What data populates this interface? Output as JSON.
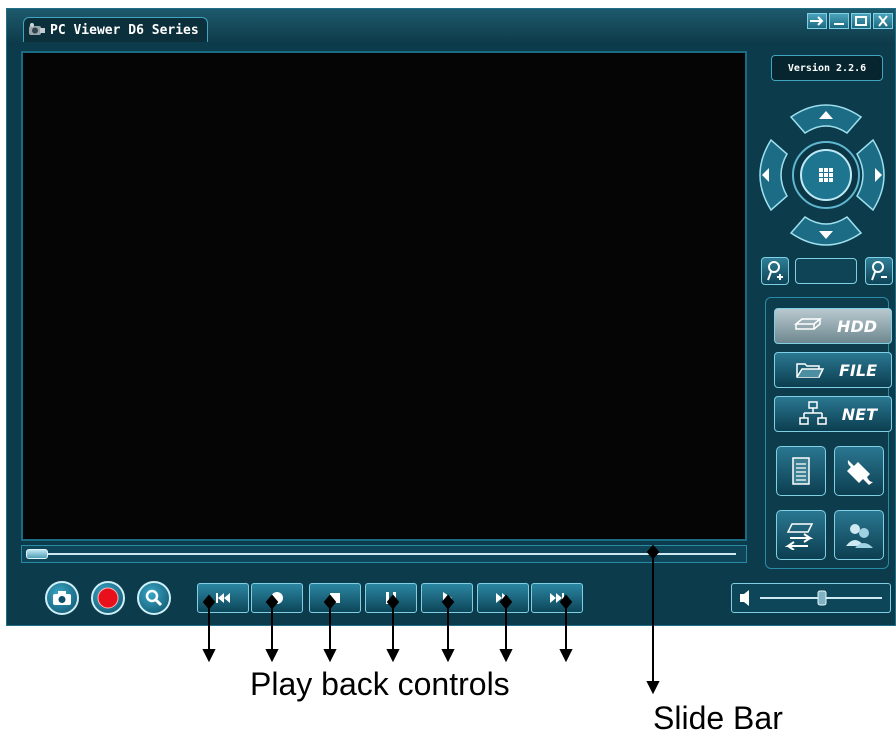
{
  "window": {
    "title": "PC Viewer D6 Series",
    "version": "Version 2.2.6",
    "controls": [
      "pin-icon",
      "minimize-icon",
      "maximize-icon",
      "close-icon"
    ]
  },
  "modes": [
    {
      "id": "hdd",
      "label": "HDD",
      "icon": "hdd-icon",
      "active": true
    },
    {
      "id": "file",
      "label": "FILE",
      "icon": "folder-icon",
      "active": false
    },
    {
      "id": "net",
      "label": "NET",
      "icon": "network-icon",
      "active": false
    }
  ],
  "tools": [
    "list-icon",
    "wrench-icon",
    "backup-icon",
    "users-icon"
  ],
  "left_buttons": [
    "camera-icon",
    "record-icon",
    "search-icon"
  ],
  "playback": [
    "skip-back-icon",
    "record-dot-icon",
    "stop-icon",
    "pause-icon",
    "play-icon",
    "fast-forward-icon",
    "skip-forward-icon"
  ],
  "annotations": {
    "playback_label": "Play back controls",
    "slide_label": "Slide Bar"
  },
  "colors": {
    "panel": "#0c3b4c",
    "accent": "#7fd0e4",
    "video": "#050505",
    "record_red": "#e8101a"
  }
}
